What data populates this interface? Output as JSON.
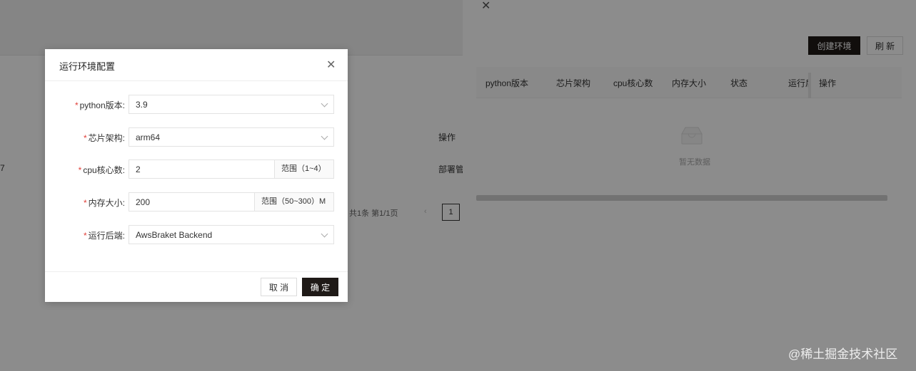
{
  "background": {
    "op_header": "操作",
    "row_left_fragment": "7",
    "row_link_fragment": "部署管",
    "pager_text": "共1条 第1/1页",
    "pager_prev": "‹",
    "pager_current": "1"
  },
  "drawer": {
    "close_icon": "close-icon",
    "create_button": "创建环境",
    "refresh_button": "刷 新",
    "columns": [
      "python版本",
      "芯片架构",
      "cpu核心数",
      "内存大小",
      "状态",
      "运行后",
      "操作"
    ],
    "empty_text": "暂无数据"
  },
  "modal": {
    "title": "运行环境配置",
    "fields": [
      {
        "label": "python版本:",
        "value": "3.9"
      },
      {
        "label": "芯片架构:",
        "value": "arm64"
      },
      {
        "label": "cpu核心数:",
        "value": "2",
        "addon": "范围（1~4）"
      },
      {
        "label": "内存大小:",
        "value": "200",
        "addon": "范围（50~300）M"
      },
      {
        "label": "运行后端:",
        "value": "AwsBraket Backend"
      }
    ],
    "required_mark": "*",
    "cancel_button": "取 消",
    "ok_button": "确 定"
  },
  "watermark": "@稀土掘金技术社区",
  "colors": {
    "primary": "#1f1a17",
    "required": "#e0403a"
  }
}
